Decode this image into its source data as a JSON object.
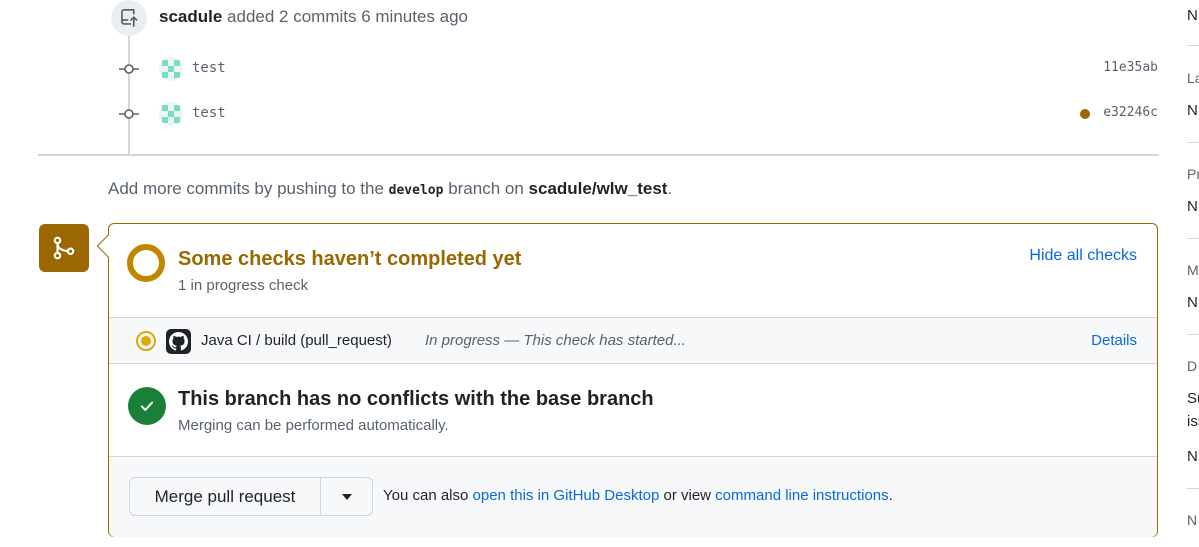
{
  "timeline": {
    "actor": "scadule",
    "event_text": "added 2 commits 6 minutes ago",
    "commits": [
      {
        "message": "test",
        "sha": "11e35ab",
        "has_status": false
      },
      {
        "message": "test",
        "sha": "e32246c",
        "has_status": true
      }
    ],
    "push_hint": {
      "prefix": "Add more commits by pushing to the",
      "branch": "develop",
      "middle": "branch on",
      "repo": "scadule/wlw_test",
      "suffix": "."
    }
  },
  "checks": {
    "title": "Some checks haven’t completed yet",
    "subtitle": "1 in progress check",
    "hide_label": "Hide all checks",
    "items": [
      {
        "name": "Java CI / build (pull_request)",
        "description": "In progress — This check has started...",
        "details_label": "Details"
      }
    ]
  },
  "conflicts": {
    "title": "This branch has no conflicts with the base branch",
    "subtitle": "Merging can be performed automatically."
  },
  "merge": {
    "button_label": "Merge pull request",
    "info_prefix": "You can also",
    "desktop_link": "open this in GitHub Desktop",
    "info_middle": "or view",
    "cli_link": "command line instructions",
    "info_suffix": "."
  },
  "sidebar": {
    "items": [
      "N",
      "La",
      "N",
      "Pr",
      "N",
      "M",
      "N",
      "D",
      "Su",
      "iss",
      "N",
      "N"
    ]
  },
  "colors": {
    "pending": "#9a6700",
    "success": "#1a7f37",
    "link": "#0969da"
  }
}
